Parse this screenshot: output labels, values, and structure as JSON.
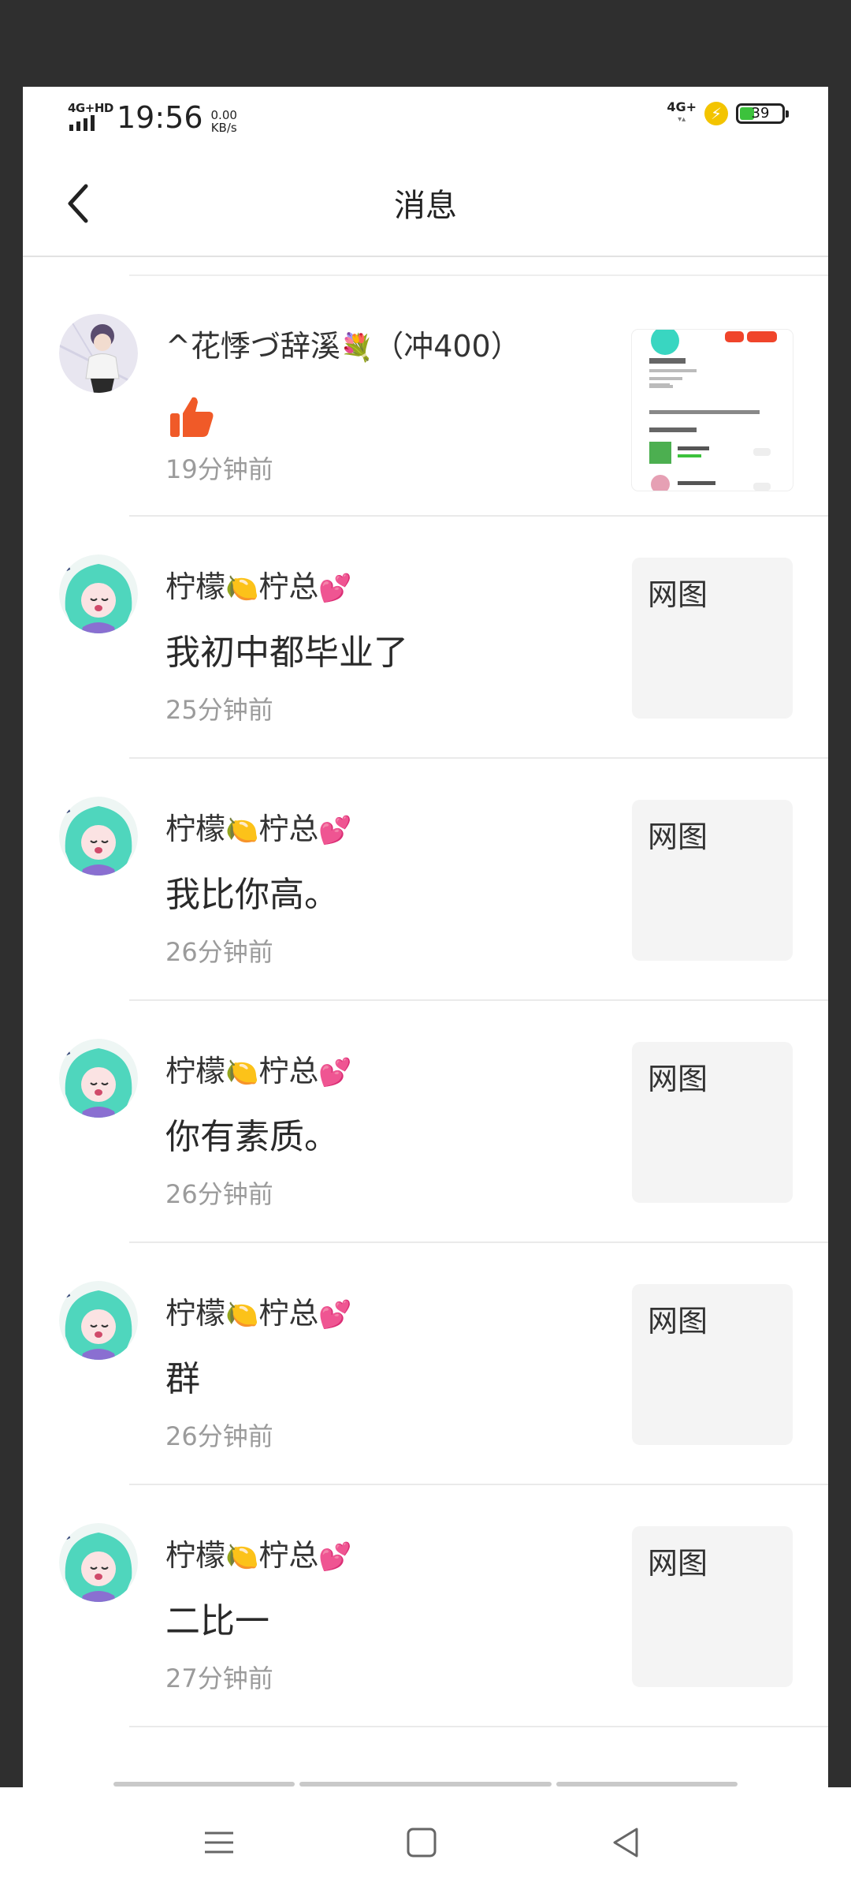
{
  "status_bar": {
    "network_label": "4G+HD",
    "time": "19:56",
    "speed_value": "0.00",
    "speed_unit": "KB/s",
    "right_network": "4G+",
    "battery_level": "39",
    "battery_color": "#3cc23c"
  },
  "header": {
    "title": "消息",
    "back_icon": "chevron-left-icon"
  },
  "messages": [
    {
      "sender": "^花悸づ辞溪",
      "sender_emoji": "💐",
      "sender_suffix": "（冲400）",
      "content_icon": "thumbs-up-icon",
      "time": "19分钟前",
      "thumbnail": "profile-screenshot"
    },
    {
      "sender_a": "柠檬",
      "emoji_a": "🍋",
      "sender_b": "柠总",
      "emoji_b": "💕",
      "content": "我初中都毕业了",
      "time": "25分钟前",
      "thumb_label": "网图"
    },
    {
      "sender_a": "柠檬",
      "emoji_a": "🍋",
      "sender_b": "柠总",
      "emoji_b": "💕",
      "content": "我比你高。",
      "time": "26分钟前",
      "thumb_label": "网图"
    },
    {
      "sender_a": "柠檬",
      "emoji_a": "🍋",
      "sender_b": "柠总",
      "emoji_b": "💕",
      "content": "你有素质。",
      "time": "26分钟前",
      "thumb_label": "网图"
    },
    {
      "sender_a": "柠檬",
      "emoji_a": "🍋",
      "sender_b": "柠总",
      "emoji_b": "💕",
      "content": "群",
      "time": "26分钟前",
      "thumb_label": "网图"
    },
    {
      "sender_a": "柠檬",
      "emoji_a": "🍋",
      "sender_b": "柠总",
      "emoji_b": "💕",
      "content": "二比一",
      "time": "27分钟前",
      "thumb_label": "网图"
    }
  ],
  "nav_bar": {
    "menu_icon": "menu-icon",
    "home_icon": "home-square-icon",
    "back_icon": "back-triangle-icon"
  },
  "colors": {
    "accent_red": "#f05a28",
    "time_gray": "#9b9b9b"
  }
}
